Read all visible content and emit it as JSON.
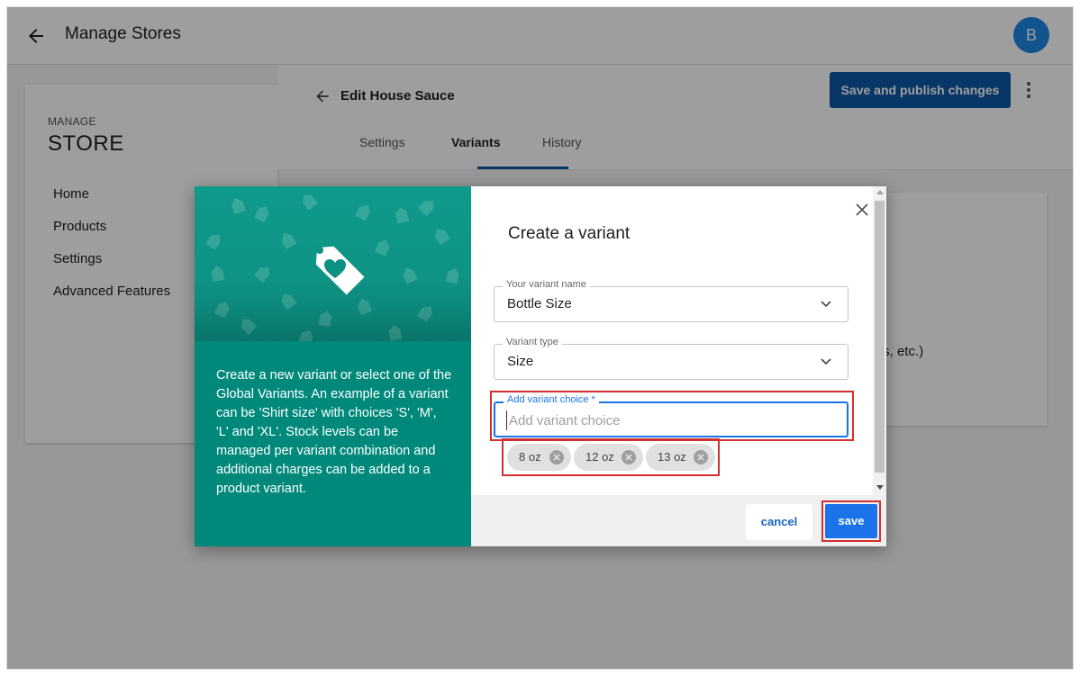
{
  "topbar": {
    "title": "Manage Stores",
    "avatar_initial": "B"
  },
  "sidebar": {
    "manage_label": "MANAGE",
    "store_label": "STORE",
    "items": [
      {
        "label": "Home"
      },
      {
        "label": "Products"
      },
      {
        "label": "Settings"
      },
      {
        "label": "Advanced Features"
      }
    ]
  },
  "main": {
    "edit_title": "Edit House Sauce",
    "publish_label": "Save and publish changes",
    "tabs": [
      {
        "label": "Settings",
        "active": false
      },
      {
        "label": "Variants",
        "active": true
      },
      {
        "label": "History",
        "active": false
      }
    ],
    "peek_text": "avors, etc.)"
  },
  "modal": {
    "description": "Create a new variant or select one of the Global Variants. An example of a variant can be 'Shirt size' with choices 'S', 'M', 'L' and 'XL'. Stock levels can be managed per variant combination and additional charges can be added to a product variant.",
    "title": "Create a variant",
    "variant_name": {
      "label": "Your variant name",
      "value": "Bottle Size"
    },
    "variant_type": {
      "label": "Variant type",
      "value": "Size"
    },
    "variant_choice": {
      "label": "Add variant choice *",
      "placeholder": "Add variant choice",
      "value": ""
    },
    "chips": [
      {
        "label": "8 oz"
      },
      {
        "label": "12 oz"
      },
      {
        "label": "13 oz"
      }
    ],
    "cancel_label": "cancel",
    "save_label": "save"
  },
  "colors": {
    "teal_panel": "#00897b",
    "primary_blue": "#1a73e8",
    "publish_blue": "#0d5aa7",
    "highlight_red": "#d32f2f"
  }
}
